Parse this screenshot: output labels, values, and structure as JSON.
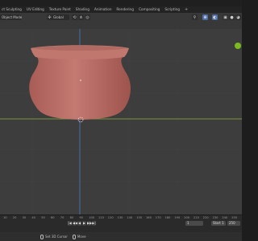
{
  "workspace_tabs": [
    "ct Sculpting",
    "UV Editing",
    "Texture Paint",
    "Shading",
    "Animation",
    "Rendering",
    "Compositing",
    "Scripting",
    "+"
  ],
  "viewport_header": {
    "mode_label": "Object Mode",
    "transform_orientation": "Global"
  },
  "timeline": {
    "ruler_ticks": [
      "10",
      "20",
      "30",
      "40",
      "50",
      "60",
      "70",
      "80",
      "90",
      "100",
      "110",
      "120",
      "130",
      "140",
      "150",
      "160",
      "170",
      "180",
      "190",
      "200",
      "210",
      "220",
      "230",
      "240",
      "250"
    ],
    "playback_buttons": [
      "|◀",
      "◀◀",
      "◀",
      "▶",
      "▶▶",
      "▶|"
    ],
    "current_frame": "1",
    "start_label": "Start",
    "start_value": "1",
    "end_value": "250"
  },
  "statusbar": {
    "action_1": "Set 3D Cursor",
    "action_2": "Move"
  },
  "colors": {
    "pot": "#b66a62",
    "axis_x": "#8fb33a",
    "axis_y": "#4b7bc2",
    "gizmo_green": "#7cbb1d"
  }
}
